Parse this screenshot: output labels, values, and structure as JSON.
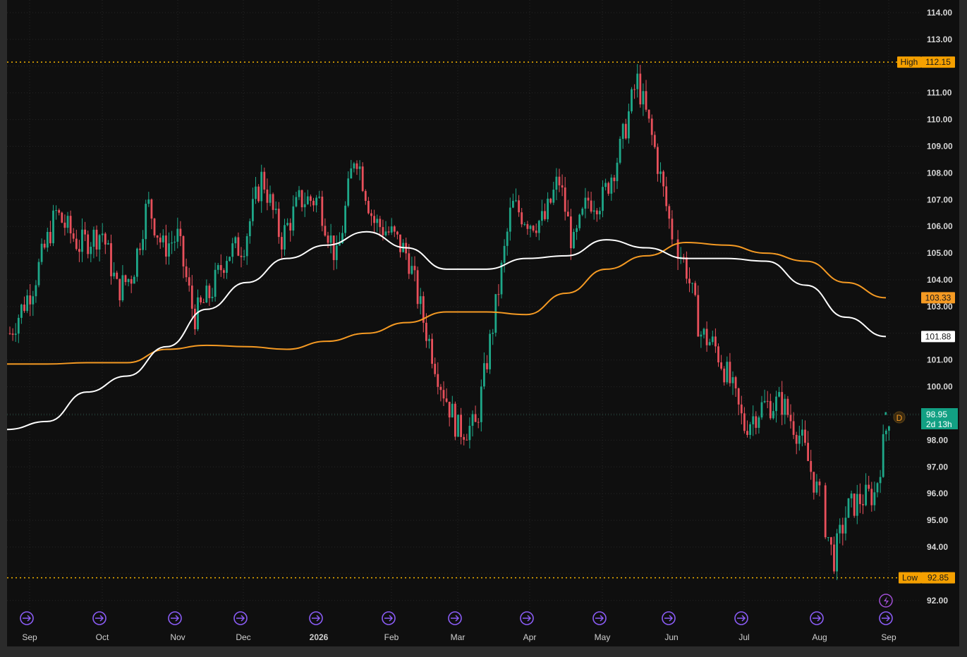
{
  "colors": {
    "background": "#0f0f0f",
    "up": "#1ea889",
    "down": "#e8505b",
    "ma_long": "#f59a23",
    "ma_short": "#ffffff",
    "event_icon": "#8a5cf5",
    "high_low_line": "#f5b400"
  },
  "price_axis": {
    "labels": [
      "114.00",
      "113.00",
      "111.00",
      "110.00",
      "109.00",
      "108.00",
      "107.00",
      "106.00",
      "105.00",
      "104.00",
      "103.00",
      "101.00",
      "100.00",
      "98.00",
      "97.00",
      "96.00",
      "95.00",
      "94.00",
      "92.00"
    ]
  },
  "time_axis": {
    "labels": [
      "Sep",
      "Oct",
      "Nov",
      "Dec",
      "2026",
      "Feb",
      "Mar",
      "Apr",
      "May",
      "Jun",
      "Jul",
      "Aug",
      "Sep"
    ]
  },
  "markers": {
    "high_label": "High",
    "high_value": "112.15",
    "low_label": "Low",
    "low_value": "92.85",
    "ma_long_value": "103.33",
    "ma_short_value": "101.88",
    "last_price": "98.95",
    "countdown": "2d 13h",
    "period_badge": "D"
  },
  "chart_data": {
    "type": "candlestick",
    "y_axis_range": [
      91.2,
      114.5
    ],
    "grid": true,
    "x_period_labels": [
      "Sep",
      "Oct",
      "Nov",
      "Dec",
      "2026",
      "Feb",
      "Mar",
      "Apr",
      "May",
      "Jun",
      "Jul",
      "Aug",
      "Sep"
    ],
    "high": 112.15,
    "low": 92.85,
    "last_price": 98.95,
    "price_path": [
      [
        "Sep",
        102.0
      ],
      [
        "Sep",
        103.8
      ],
      [
        "Sep",
        106.5
      ],
      [
        "Sep",
        105.3
      ],
      [
        "Oct",
        105.8
      ],
      [
        "Oct",
        103.6
      ],
      [
        "Oct",
        104.2
      ],
      [
        "Oct",
        106.9
      ],
      [
        "Oct",
        105.2
      ],
      [
        "Nov",
        105.6
      ],
      [
        "Nov",
        102.6
      ],
      [
        "Nov",
        103.5
      ],
      [
        "Nov",
        105.0
      ],
      [
        "Dec",
        105.3
      ],
      [
        "Dec",
        107.9
      ],
      [
        "Dec",
        105.5
      ],
      [
        "Dec",
        107.0
      ],
      [
        "2026",
        107.0
      ],
      [
        "2026",
        104.7
      ],
      [
        "2026",
        108.9
      ],
      [
        "2026",
        106.2
      ],
      [
        "Feb",
        105.7
      ],
      [
        "Feb",
        104.9
      ],
      [
        "Feb",
        102.3
      ],
      [
        "Feb",
        100.1
      ],
      [
        "Mar",
        98.4
      ],
      [
        "Mar",
        98.5
      ],
      [
        "Mar",
        102.5
      ],
      [
        "Mar",
        106.8
      ],
      [
        "Apr",
        106.2
      ],
      [
        "Apr",
        106.2
      ],
      [
        "Apr",
        107.8
      ],
      [
        "Apr",
        105.2
      ],
      [
        "Apr",
        107.0
      ],
      [
        "May",
        107.0
      ],
      [
        "May",
        108.8
      ],
      [
        "May",
        111.5
      ],
      [
        "May",
        109.0
      ],
      [
        "Jun",
        105.8
      ],
      [
        "Jun",
        104.5
      ],
      [
        "Jun",
        102.0
      ],
      [
        "Jun",
        101.5
      ],
      [
        "Jun",
        100.2
      ],
      [
        "Jul",
        98.5
      ],
      [
        "Jul",
        99.3
      ],
      [
        "Jul",
        99.4
      ],
      [
        "Jul",
        98.1
      ],
      [
        "Aug",
        95.8
      ],
      [
        "Aug",
        93.5
      ],
      [
        "Aug",
        95.4
      ],
      [
        "Aug",
        95.8
      ],
      [
        "Aug",
        96.0
      ],
      [
        "Sep",
        98.95
      ]
    ],
    "series": [
      {
        "name": "103.33",
        "color": "#f59a23",
        "values": [
          100.85,
          100.85,
          100.9,
          100.9,
          101.4,
          101.55,
          101.5,
          101.4,
          101.7,
          102.0,
          102.4,
          102.8,
          102.8,
          102.7,
          103.5,
          104.4,
          104.9,
          105.4,
          105.3,
          105.0,
          104.7,
          103.9,
          103.33
        ]
      },
      {
        "name": "101.88",
        "color": "#ffffff",
        "values": [
          98.4,
          98.7,
          99.8,
          100.4,
          101.5,
          102.9,
          103.9,
          104.8,
          105.3,
          105.8,
          105.2,
          104.4,
          104.4,
          104.8,
          104.9,
          105.5,
          105.2,
          104.8,
          104.8,
          104.7,
          103.8,
          102.6,
          101.88
        ]
      }
    ]
  }
}
